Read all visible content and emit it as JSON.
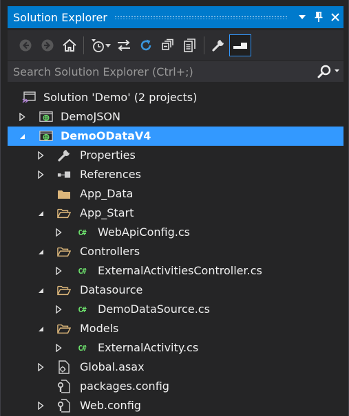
{
  "window": {
    "title": "Solution Explorer"
  },
  "search": {
    "placeholder": "Search Solution Explorer (Ctrl+;)"
  },
  "tree": [
    {
      "label": "Solution 'Demo' (2 projects)",
      "icon": "solution-icon"
    },
    {
      "label": "DemoJSON",
      "icon": "web-project-icon",
      "expander": "collapsed"
    },
    {
      "label": "DemoODataV4",
      "icon": "web-project-icon",
      "expander": "expanded",
      "selected": true
    },
    {
      "label": "Properties",
      "icon": "wrench-icon",
      "expander": "collapsed"
    },
    {
      "label": "References",
      "icon": "references-icon",
      "expander": "collapsed"
    },
    {
      "label": "App_Data",
      "icon": "folder-icon"
    },
    {
      "label": "App_Start",
      "icon": "folder-open-icon",
      "expander": "expanded"
    },
    {
      "label": "WebApiConfig.cs",
      "icon": "csharp-file-icon",
      "expander": "collapsed"
    },
    {
      "label": "Controllers",
      "icon": "folder-open-icon",
      "expander": "expanded"
    },
    {
      "label": "ExternalActivitiesController.cs",
      "icon": "csharp-file-icon",
      "expander": "collapsed"
    },
    {
      "label": "Datasource",
      "icon": "folder-open-icon",
      "expander": "expanded"
    },
    {
      "label": "DemoDataSource.cs",
      "icon": "csharp-file-icon",
      "expander": "collapsed"
    },
    {
      "label": "Models",
      "icon": "folder-open-icon",
      "expander": "expanded"
    },
    {
      "label": "ExternalActivity.cs",
      "icon": "csharp-file-icon",
      "expander": "collapsed"
    },
    {
      "label": "Global.asax",
      "icon": "global-asax-icon",
      "expander": "collapsed"
    },
    {
      "label": "packages.config",
      "icon": "config-file-icon"
    },
    {
      "label": "Web.config",
      "icon": "config-file-icon",
      "expander": "collapsed"
    }
  ],
  "colors": {
    "accent": "#007acc",
    "selection": "#3399ff",
    "background": "#252526",
    "folder": "#dcb67a",
    "csharp": "#6de26d"
  }
}
